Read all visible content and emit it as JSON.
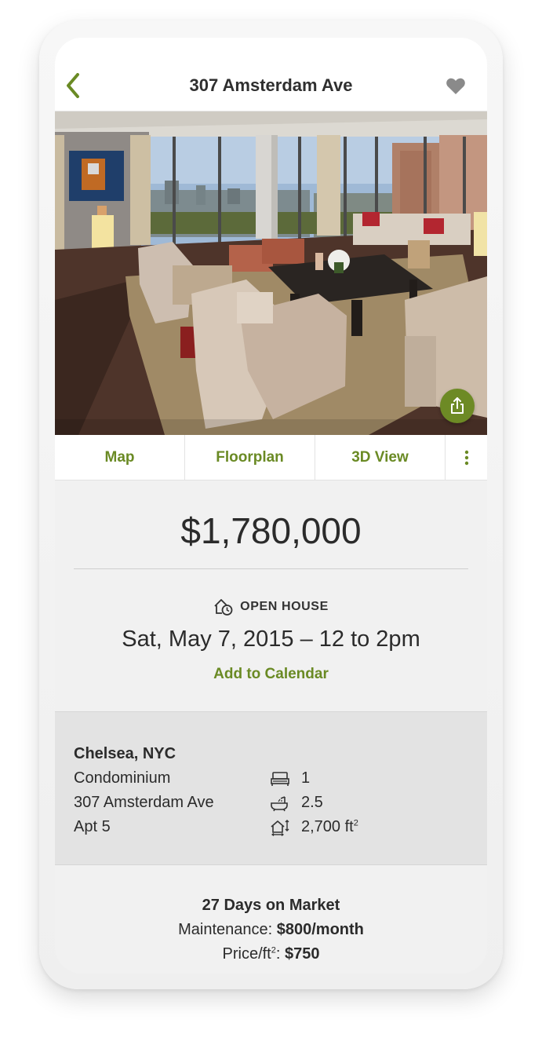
{
  "header": {
    "title": "307 Amsterdam Ave"
  },
  "icons": {
    "back": "chevron-left-icon",
    "favorite": "heart-icon",
    "share": "share-icon",
    "more": "more-vertical-icon",
    "open_house": "house-clock-icon",
    "bed": "bed-icon",
    "bath": "bathtub-icon",
    "area": "area-icon"
  },
  "tabs": [
    {
      "label": "Map"
    },
    {
      "label": "Floorplan"
    },
    {
      "label": "3D View"
    }
  ],
  "listing": {
    "price": "$1,780,000",
    "open_house_label": "OPEN HOUSE",
    "open_house_date": "Sat, May 7, 2015 – 12 to 2pm",
    "add_to_calendar": "Add to Calendar"
  },
  "details": {
    "neighborhood": "Chelsea, NYC",
    "type": "Condominium",
    "address": "307 Amsterdam Ave",
    "unit": "Apt 5",
    "beds": "1",
    "baths": "2.5",
    "area_value": "2,700 ft",
    "area_sup": "2"
  },
  "market": {
    "days": "27 Days on Market",
    "maintenance_label": "Maintenance: ",
    "maintenance_value": "$800/month",
    "price_per_label": "Price/ft",
    "price_per_sup": "2",
    "price_per_sep": ": ",
    "price_per_value": "$750"
  },
  "colors": {
    "accent_green": "#6a8a24",
    "share_button": "#6d8a25",
    "text_dark": "#2b2b2b",
    "details_bg": "#e3e3e3"
  }
}
